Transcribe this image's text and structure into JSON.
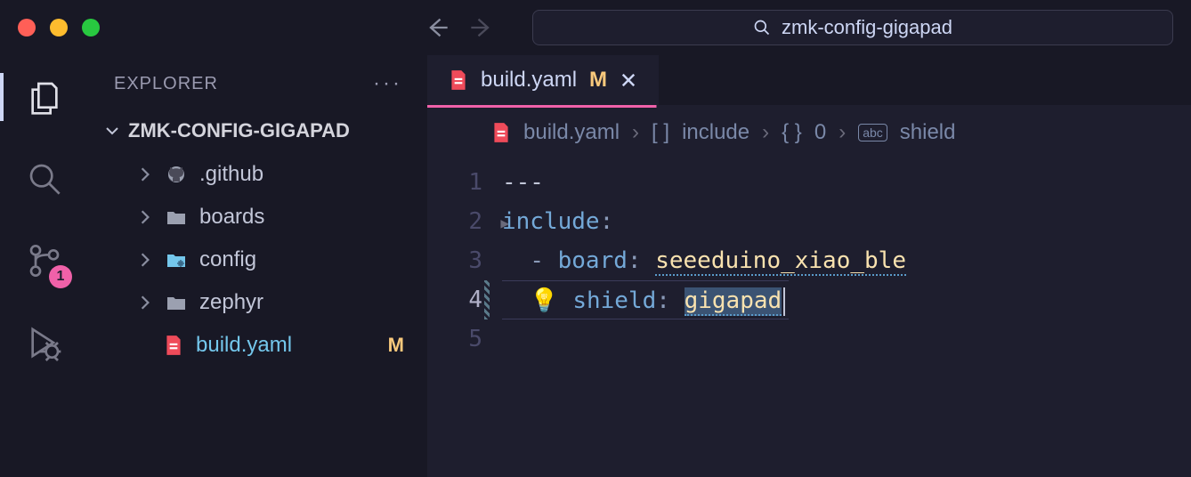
{
  "command_center": {
    "text": "zmk-config-gigapad"
  },
  "sidebar": {
    "title": "EXPLORER",
    "root": "ZMK-CONFIG-GIGAPAD",
    "items": [
      {
        "name": ".github",
        "type": "github"
      },
      {
        "name": "boards",
        "type": "folder"
      },
      {
        "name": "config",
        "type": "folder-gear"
      },
      {
        "name": "zephyr",
        "type": "folder"
      }
    ],
    "file": {
      "name": "build.yaml",
      "modified": "M"
    }
  },
  "activity": {
    "scm_badge": "1"
  },
  "tab": {
    "filename": "build.yaml",
    "modified": "M"
  },
  "breadcrumb": {
    "file": "build.yaml",
    "seg1": "include",
    "seg2": "0",
    "seg3": "shield"
  },
  "code": {
    "l1": "---",
    "l2_key": "include",
    "l3_key": "board",
    "l3_val": "seeeduino_xiao_ble",
    "l4_key": "shield",
    "l4_val": "gigapad",
    "line_numbers": [
      "1",
      "2",
      "3",
      "4",
      "5"
    ]
  }
}
